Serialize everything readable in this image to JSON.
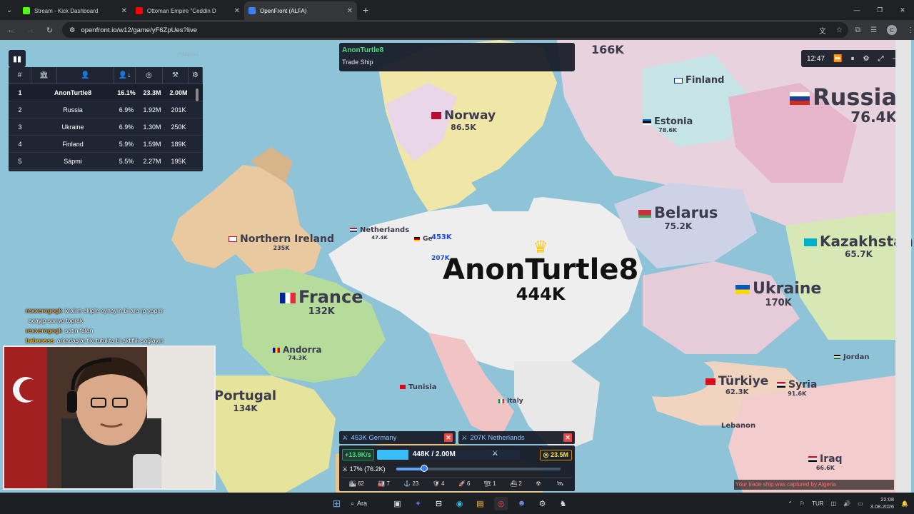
{
  "browser": {
    "tabs": [
      {
        "title": "Stream - Kick Dashboard",
        "color": "#53fc18",
        "glyph": "K",
        "active": false
      },
      {
        "title": "Ottoman Empire \"Ceddin D",
        "color": "#ff0000",
        "glyph": "▶",
        "active": false
      },
      {
        "title": "OpenFront (ALFA)",
        "color": "#3b82f6",
        "glyph": "❯",
        "active": true
      }
    ],
    "url": "openfront.io/w12/game/yF6ZpUes?live",
    "profile_initial": "C"
  },
  "game": {
    "game_code": "yF6ZpUes",
    "leaderboard": {
      "headers": [
        "#",
        "🏛",
        "👤",
        "👤↓",
        "◎",
        "⚒",
        "⚙"
      ],
      "rows": [
        {
          "rank": "1",
          "name": "AnonTurtle8",
          "share": "16.1%",
          "gold": "23.3M",
          "troops": "2.00M"
        },
        {
          "rank": "2",
          "name": "Russia",
          "share": "6.9%",
          "gold": "1.92M",
          "troops": "201K"
        },
        {
          "rank": "3",
          "name": "Ukraine",
          "share": "6.9%",
          "gold": "1.30M",
          "troops": "250K"
        },
        {
          "rank": "4",
          "name": "Finland",
          "share": "5.9%",
          "gold": "1.59M",
          "troops": "189K"
        },
        {
          "rank": "5",
          "name": "Sápmi",
          "share": "5.5%",
          "gold": "2.27M",
          "troops": "195K"
        }
      ]
    },
    "notification": {
      "player": "AnonTurtle8",
      "message": "Trade Ship"
    },
    "timer": "12:47",
    "map_labels": [
      {
        "name": "AnonTurtle8",
        "pop": "444K"
      },
      {
        "name": "Russia",
        "pop": "76.4K"
      },
      {
        "name": "Norway",
        "pop": "86.5K"
      },
      {
        "name": "Finland",
        "pop": ""
      },
      {
        "name": "Estonia",
        "pop": "78.6K"
      },
      {
        "name": "Belarus",
        "pop": "75.2K"
      },
      {
        "name": "Kazakhstan",
        "pop": "65.7K"
      },
      {
        "name": "Ukraine",
        "pop": "170K"
      },
      {
        "name": "France",
        "pop": "132K"
      },
      {
        "name": "Northern Ireland",
        "pop": "235K"
      },
      {
        "name": "Netherlands",
        "pop": "47.4K"
      },
      {
        "name": "Andorra",
        "pop": "74.3K"
      },
      {
        "name": "Portugal",
        "pop": "134K"
      },
      {
        "name": "Türkiye",
        "pop": "62.3K"
      },
      {
        "name": "Syria",
        "pop": "91.6K"
      },
      {
        "name": "Lebanon",
        "pop": ""
      },
      {
        "name": "Jordan",
        "pop": ""
      },
      {
        "name": "Iraq",
        "pop": "66.6K"
      },
      {
        "name": "Tunisia",
        "pop": ""
      },
      {
        "name": "Italy",
        "pop": ""
      },
      {
        "name": "Ge",
        "pop": ""
      }
    ],
    "top_pops": {
      "north": "166K",
      "germany_attack": "453K",
      "nl_attack": "207K"
    },
    "attacks": [
      {
        "label": "453K  Germany"
      },
      {
        "label": "207K  Netherlands"
      }
    ],
    "rate": "+13.9K/s",
    "troops": "448K / 2.00M",
    "troop_fill": 0.22,
    "gold": "23.5M",
    "attack_ratio": "17% (76.2K)",
    "attack_ratio_value": 0.17,
    "buildings": [
      {
        "icon": "🏙",
        "count": "62"
      },
      {
        "icon": "🏭",
        "count": "7"
      },
      {
        "icon": "⚓",
        "count": "23"
      },
      {
        "icon": "🛡",
        "count": "4"
      },
      {
        "icon": "🚀",
        "count": "6"
      },
      {
        "icon": "🏗",
        "count": "1"
      },
      {
        "icon": "⛴",
        "count": "2"
      },
      {
        "icon": "☢",
        "count": ""
      },
      {
        "icon": "🛰",
        "count": ""
      }
    ],
    "toast": "Your trade ship was captured by Algeria"
  },
  "chat": [
    {
      "user": "rexxerogogk",
      "text": "kralım ekiple oynayın bi ara rp yapın"
    },
    {
      "user": "",
      "text": "acayip sarıyo toprak"
    },
    {
      "user": "rexxerogogk",
      "text": "satın falan"
    },
    {
      "user": "baboosss",
      "text": "arkadaşlar tiki tutukta bi aktiflik sağlayın"
    }
  ],
  "taskbar": {
    "search": "Ara",
    "lang": "TUR",
    "time": "22:08",
    "date": "3.08.2026"
  }
}
